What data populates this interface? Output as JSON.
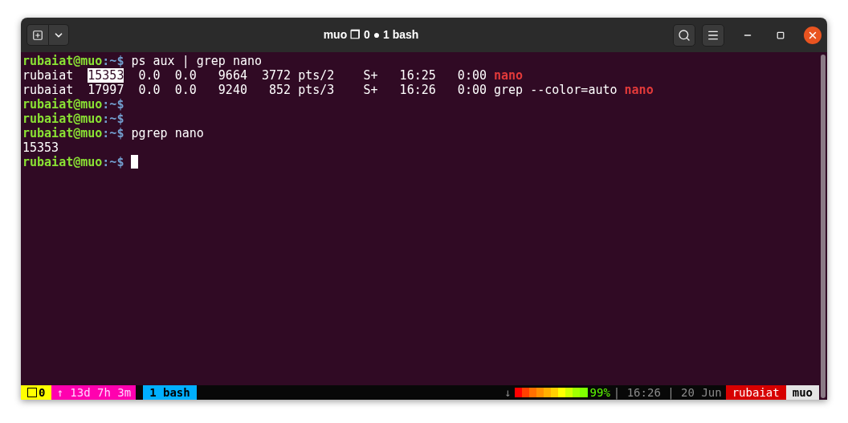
{
  "window": {
    "title": "muo ❐ 0 ● 1 bash"
  },
  "terminal": {
    "lines": [
      {
        "kind": "prompt",
        "user": "rubaiat@muo",
        "path": ":~$",
        "command": " ps aux | grep nano"
      },
      {
        "kind": "output",
        "segments": [
          {
            "text": "rubaiat  ",
            "kind": "plain"
          },
          {
            "text": "15353",
            "kind": "highlight"
          },
          {
            "text": "  0.0  0.0   9664  3772 pts/2    S+   16:25   0:00 ",
            "kind": "plain"
          },
          {
            "text": "nano",
            "kind": "match"
          }
        ]
      },
      {
        "kind": "output",
        "segments": [
          {
            "text": "rubaiat  17997  0.0  0.0   9240   852 pts/3    S+   16:26   0:00 grep --color=auto ",
            "kind": "plain"
          },
          {
            "text": "nano",
            "kind": "match"
          }
        ]
      },
      {
        "kind": "prompt",
        "user": "rubaiat@muo",
        "path": ":~$"
      },
      {
        "kind": "prompt",
        "user": "rubaiat@muo",
        "path": ":~$"
      },
      {
        "kind": "prompt",
        "user": "rubaiat@muo",
        "path": ":~$",
        "command": " pgrep nano"
      },
      {
        "kind": "output",
        "segments": [
          {
            "text": "15353",
            "kind": "plain"
          }
        ]
      },
      {
        "kind": "prompt",
        "user": "rubaiat@muo",
        "path": ":~$",
        "cursor": true
      }
    ]
  },
  "status_bar": {
    "session": "0",
    "uptime": "↑ 13d 7h 3m",
    "window_tab": "1 bash",
    "download": "↓",
    "battery": {
      "level": 0.99
    },
    "battery_reading": "99%",
    "clock": "| 16:26 | 20 Jun",
    "user": "rubaiat",
    "host": "muo"
  }
}
